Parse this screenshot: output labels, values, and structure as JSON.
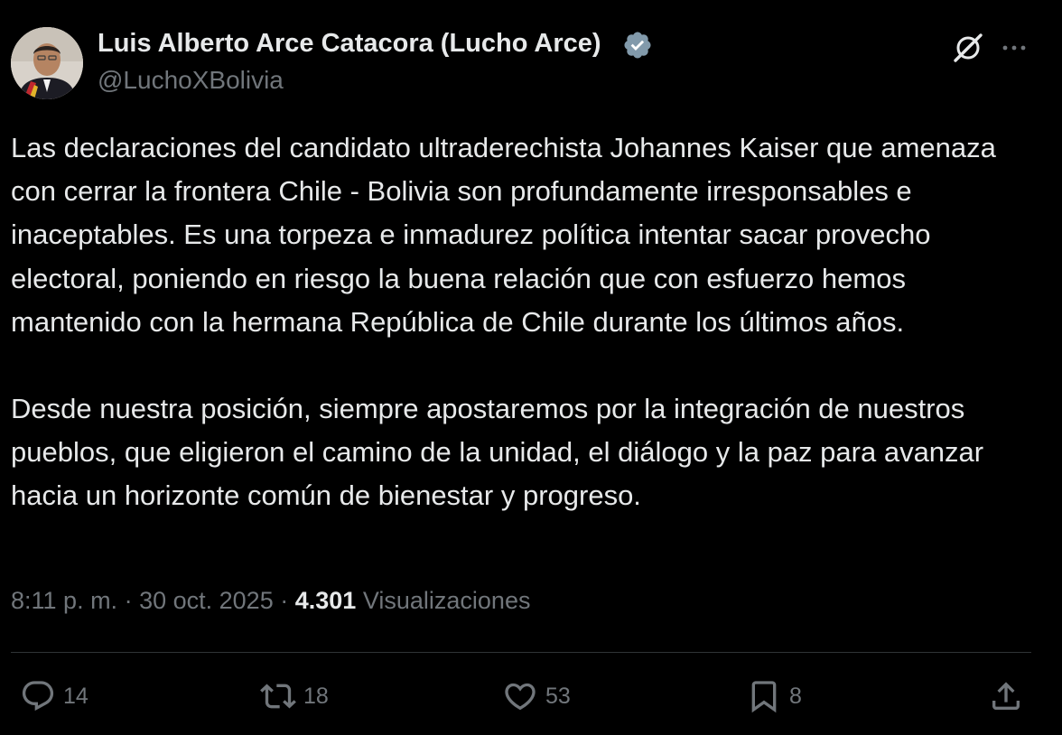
{
  "author": {
    "name": "Luis Alberto Arce Catacora (Lucho Arce)",
    "handle": "@LuchoXBolivia",
    "verified": true,
    "avatar_icon": "avatar-portrait"
  },
  "header_actions": {
    "grok_icon": "grok-icon",
    "more_icon": "more-icon"
  },
  "tweet": {
    "paragraphs": [
      "Las declaraciones del candidato ultraderechista Johannes Kaiser que amenaza con cerrar la frontera Chile - Bolivia son profundamente irresponsables e inaceptables. Es una torpeza e inmadurez política intentar sacar provecho electoral, poniendo en riesgo la buena relación que con esfuerzo hemos mantenido con la hermana República de Chile durante los últimos años.",
      "Desde nuestra posición, siempre apostaremos por la integración de nuestros pueblos, que eligieron el camino de la unidad, el diálogo y la paz para avanzar hacia un horizonte común de bienestar y progreso."
    ]
  },
  "meta": {
    "time": "8:11 p. m.",
    "separator": "·",
    "date": "30 oct. 2025",
    "views_count": "4.301",
    "views_label": "Visualizaciones"
  },
  "actions": {
    "replies": "14",
    "reposts": "18",
    "likes": "53",
    "bookmarks": "8"
  },
  "colors": {
    "background": "#000000",
    "primary_text": "#e7e9ea",
    "secondary_text": "#71767b",
    "divider": "#2f3336",
    "verified_badge": "#829aab"
  }
}
